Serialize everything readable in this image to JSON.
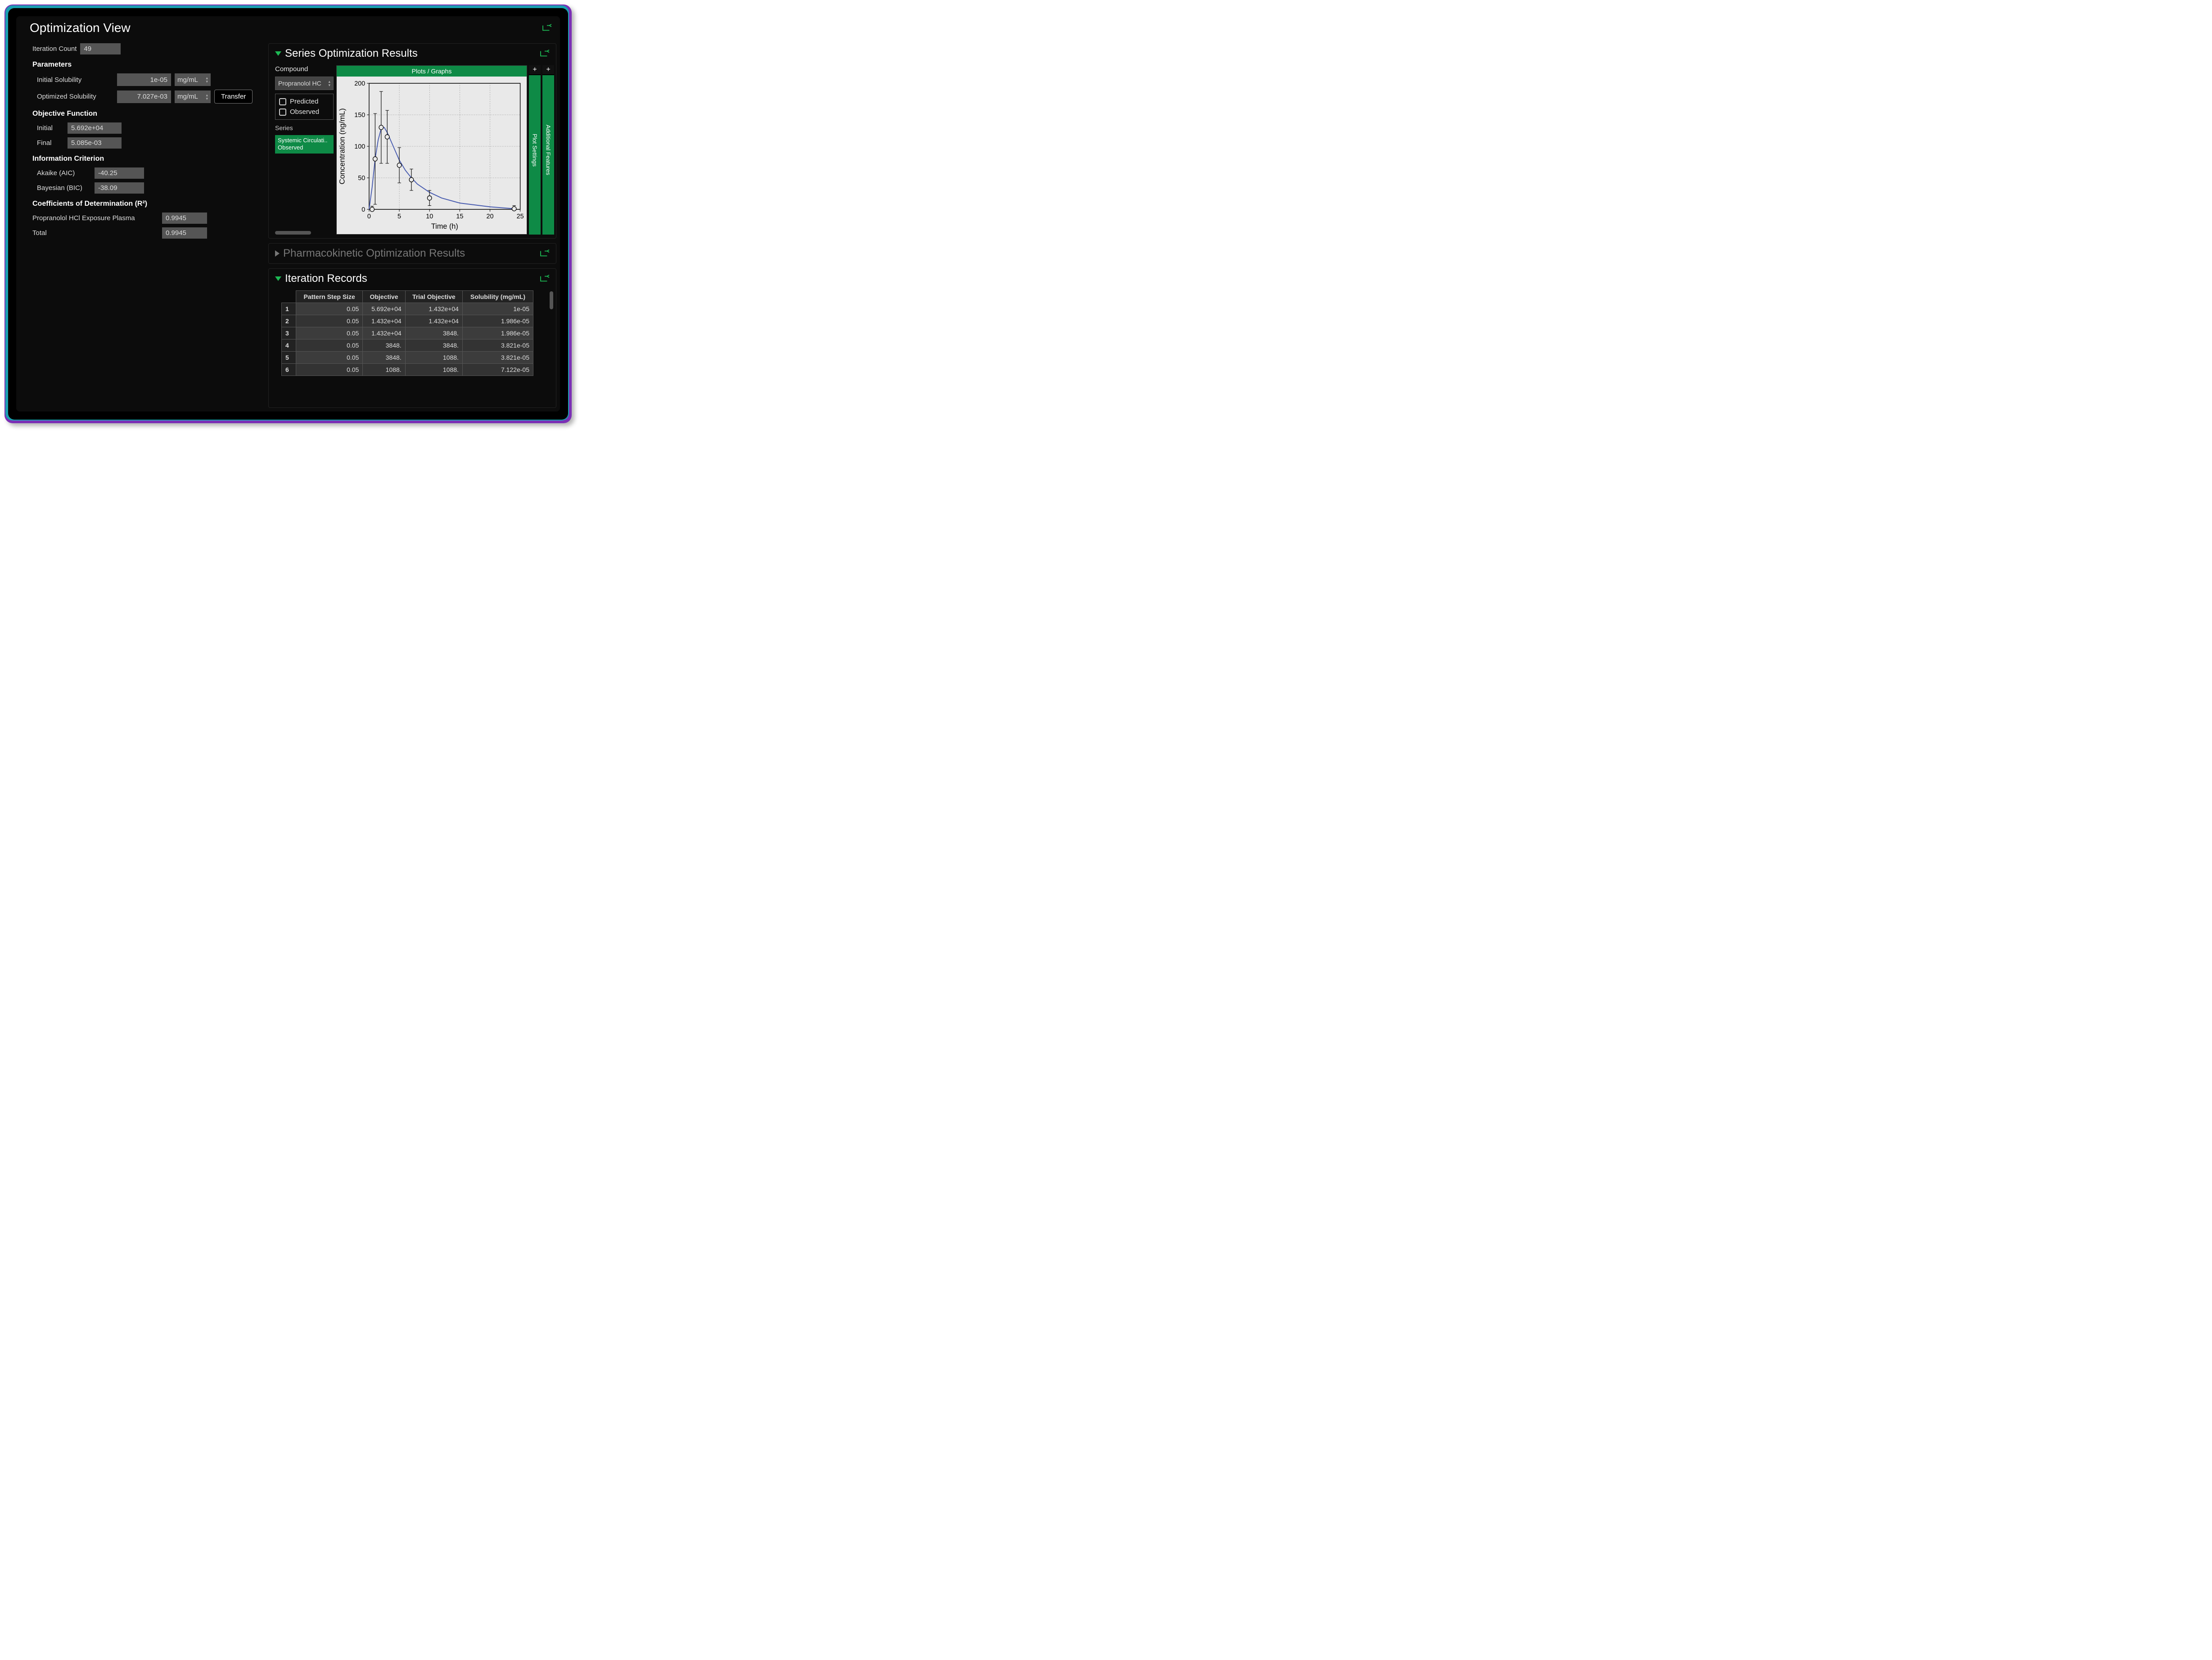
{
  "title": "Optimization View",
  "iteration": {
    "label": "Iteration Count",
    "value": "49"
  },
  "parameters": {
    "heading": "Parameters",
    "rows": [
      {
        "label": "Initial Solubility",
        "value": "1e-05",
        "unit": "mg/mL"
      },
      {
        "label": "Optimized Solubility",
        "value": "7.027e-03",
        "unit": "mg/mL"
      }
    ],
    "transfer_label": "Transfer"
  },
  "objective": {
    "heading": "Objective Function",
    "initial_label": "Initial",
    "initial_value": "5.692e+04",
    "final_label": "Final",
    "final_value": "5.085e-03"
  },
  "info_criterion": {
    "heading": "Information Criterion",
    "aic_label": "Akaike (AIC)",
    "aic_value": "-40.25",
    "bic_label": "Bayesian (BIC)",
    "bic_value": "-38.09"
  },
  "r2": {
    "heading": "Coefficients of Determination (R²)",
    "rows": [
      {
        "label": "Propranolol HCl Exposure Plasma",
        "value": "0.9945"
      },
      {
        "label": "Total",
        "value": "0.9945"
      }
    ]
  },
  "series_panel": {
    "title": "Series Optimization Results",
    "compound_label": "Compound",
    "compound_value": "Propranolol HC",
    "legend": {
      "predicted": "Predicted",
      "observed": "Observed"
    },
    "series_label": "Series",
    "series_value_line1": "Systemic Circulati..",
    "series_value_line2": "Observed",
    "chart_tab": "Plots / Graphs",
    "side1": "Plot Settings",
    "side2": "Additional Features"
  },
  "pk_panel": {
    "title": "Pharmacokinetic Optimization Results"
  },
  "iterations_panel": {
    "title": "Iteration Records",
    "columns": [
      "Pattern Step Size",
      "Objective",
      "Trial Objective",
      "Solubility (mg/mL)"
    ],
    "rows": [
      {
        "i": "1",
        "step": "0.05",
        "obj": "5.692e+04",
        "trial": "1.432e+04",
        "sol": "1e-05"
      },
      {
        "i": "2",
        "step": "0.05",
        "obj": "1.432e+04",
        "trial": "1.432e+04",
        "sol": "1.986e-05"
      },
      {
        "i": "3",
        "step": "0.05",
        "obj": "1.432e+04",
        "trial": "3848.",
        "sol": "1.986e-05"
      },
      {
        "i": "4",
        "step": "0.05",
        "obj": "3848.",
        "trial": "3848.",
        "sol": "3.821e-05"
      },
      {
        "i": "5",
        "step": "0.05",
        "obj": "3848.",
        "trial": "1088.",
        "sol": "3.821e-05"
      },
      {
        "i": "6",
        "step": "0.05",
        "obj": "1088.",
        "trial": "1088.",
        "sol": "7.122e-05"
      }
    ]
  },
  "chart_data": {
    "type": "line",
    "title": "",
    "xlabel": "Time (h)",
    "ylabel": "Concentration (ng/mL)",
    "xlim": [
      0,
      25
    ],
    "ylim": [
      0,
      200
    ],
    "xticks": [
      0,
      5,
      10,
      15,
      20,
      25
    ],
    "yticks": [
      0,
      50,
      100,
      150,
      200
    ],
    "series": [
      {
        "name": "Predicted",
        "kind": "line",
        "x": [
          0,
          0.5,
          1,
          1.5,
          2,
          2.5,
          3,
          4,
          5,
          6,
          7,
          8,
          10,
          12,
          15,
          20,
          24
        ],
        "y": [
          0,
          35,
          80,
          110,
          128,
          130,
          122,
          100,
          78,
          62,
          50,
          40,
          27,
          18,
          10,
          4,
          1
        ]
      },
      {
        "name": "Observed",
        "kind": "scatter_err",
        "x": [
          0.5,
          1,
          2,
          3,
          5,
          7,
          10,
          24
        ],
        "y": [
          0,
          80,
          130,
          115,
          70,
          47,
          18,
          1
        ],
        "err": [
          5,
          72,
          57,
          42,
          28,
          17,
          12,
          5
        ]
      }
    ]
  }
}
